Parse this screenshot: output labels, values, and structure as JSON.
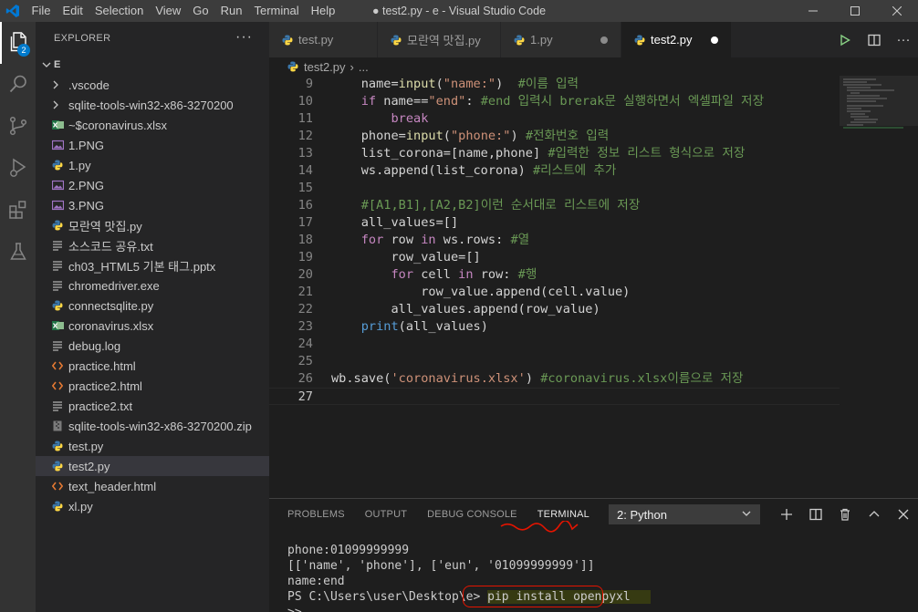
{
  "titlebar": {
    "menus": [
      "File",
      "Edit",
      "Selection",
      "View",
      "Go",
      "Run",
      "Terminal",
      "Help"
    ],
    "title": "● test2.py - e - Visual Studio Code"
  },
  "activity": {
    "explorer_badge": "2"
  },
  "sidebar": {
    "header": "EXPLORER",
    "more": "···",
    "section": "E",
    "items": [
      {
        "label": ".vscode",
        "kind": "folder",
        "color": "#c5c5c5"
      },
      {
        "label": "sqlite-tools-win32-x86-3270200",
        "kind": "folder",
        "color": "#c5c5c5"
      },
      {
        "label": "~$coronavirus.xlsx",
        "kind": "excel",
        "color": "#207245"
      },
      {
        "label": "1.PNG",
        "kind": "image",
        "color": "#a074c4"
      },
      {
        "label": "1.py",
        "kind": "python",
        "color": "#3572a5"
      },
      {
        "label": "2.PNG",
        "kind": "image",
        "color": "#a074c4"
      },
      {
        "label": "3.PNG",
        "kind": "image",
        "color": "#a074c4"
      },
      {
        "label": "모란역 맛집.py",
        "kind": "python",
        "color": "#3572a5"
      },
      {
        "label": "소스코드 공유.txt",
        "kind": "text",
        "color": "#cccccc"
      },
      {
        "label": "ch03_HTML5 기본 태그.pptx",
        "kind": "doc",
        "color": "#cccccc"
      },
      {
        "label": "chromedriver.exe",
        "kind": "exe",
        "color": "#cccccc"
      },
      {
        "label": "connectsqlite.py",
        "kind": "python",
        "color": "#3572a5"
      },
      {
        "label": "coronavirus.xlsx",
        "kind": "excel",
        "color": "#207245"
      },
      {
        "label": "debug.log",
        "kind": "text",
        "color": "#cccccc"
      },
      {
        "label": "practice.html",
        "kind": "html",
        "color": "#e37933"
      },
      {
        "label": "practice2.html",
        "kind": "html",
        "color": "#e37933"
      },
      {
        "label": "practice2.txt",
        "kind": "text",
        "color": "#cccccc"
      },
      {
        "label": "sqlite-tools-win32-x86-3270200.zip",
        "kind": "zip",
        "color": "#cccccc"
      },
      {
        "label": "test.py",
        "kind": "python",
        "color": "#3572a5"
      },
      {
        "label": "test2.py",
        "kind": "python",
        "color": "#3572a5",
        "selected": true
      },
      {
        "label": "text_header.html",
        "kind": "html",
        "color": "#e37933"
      },
      {
        "label": "xl.py",
        "kind": "python",
        "color": "#3572a5"
      }
    ]
  },
  "tabs": [
    {
      "label": "test.py",
      "dirty": false,
      "active": false
    },
    {
      "label": "모란역 맛집.py",
      "dirty": false,
      "active": false
    },
    {
      "label": "1.py",
      "dirty": true,
      "active": false
    },
    {
      "label": "test2.py",
      "dirty": true,
      "active": true
    }
  ],
  "breadcrumb": {
    "file": "test2.py",
    "sep": "›",
    "rest": "..."
  },
  "editor": {
    "lines": [
      {
        "n": "9"
      },
      {
        "n": "10"
      },
      {
        "n": "11"
      },
      {
        "n": "12"
      },
      {
        "n": "13"
      },
      {
        "n": "14"
      },
      {
        "n": "15"
      },
      {
        "n": "16"
      },
      {
        "n": "17"
      },
      {
        "n": "18"
      },
      {
        "n": "19"
      },
      {
        "n": "20"
      },
      {
        "n": "21"
      },
      {
        "n": "22"
      },
      {
        "n": "23"
      },
      {
        "n": "24"
      },
      {
        "n": "25"
      },
      {
        "n": "26"
      },
      {
        "n": "27"
      }
    ]
  },
  "panel": {
    "tabs": [
      "PROBLEMS",
      "OUTPUT",
      "DEBUG CONSOLE",
      "TERMINAL"
    ],
    "terminal_select": "2: Python",
    "terminal_lines": [
      "phone:01099999999",
      "[['name', 'phone'], ['eun', '01099999999']]",
      "name:end"
    ],
    "prompt": "PS C:\\Users\\user\\Desktop\\e> ",
    "command": "pip install openpyxl",
    "continuation": ">>"
  }
}
